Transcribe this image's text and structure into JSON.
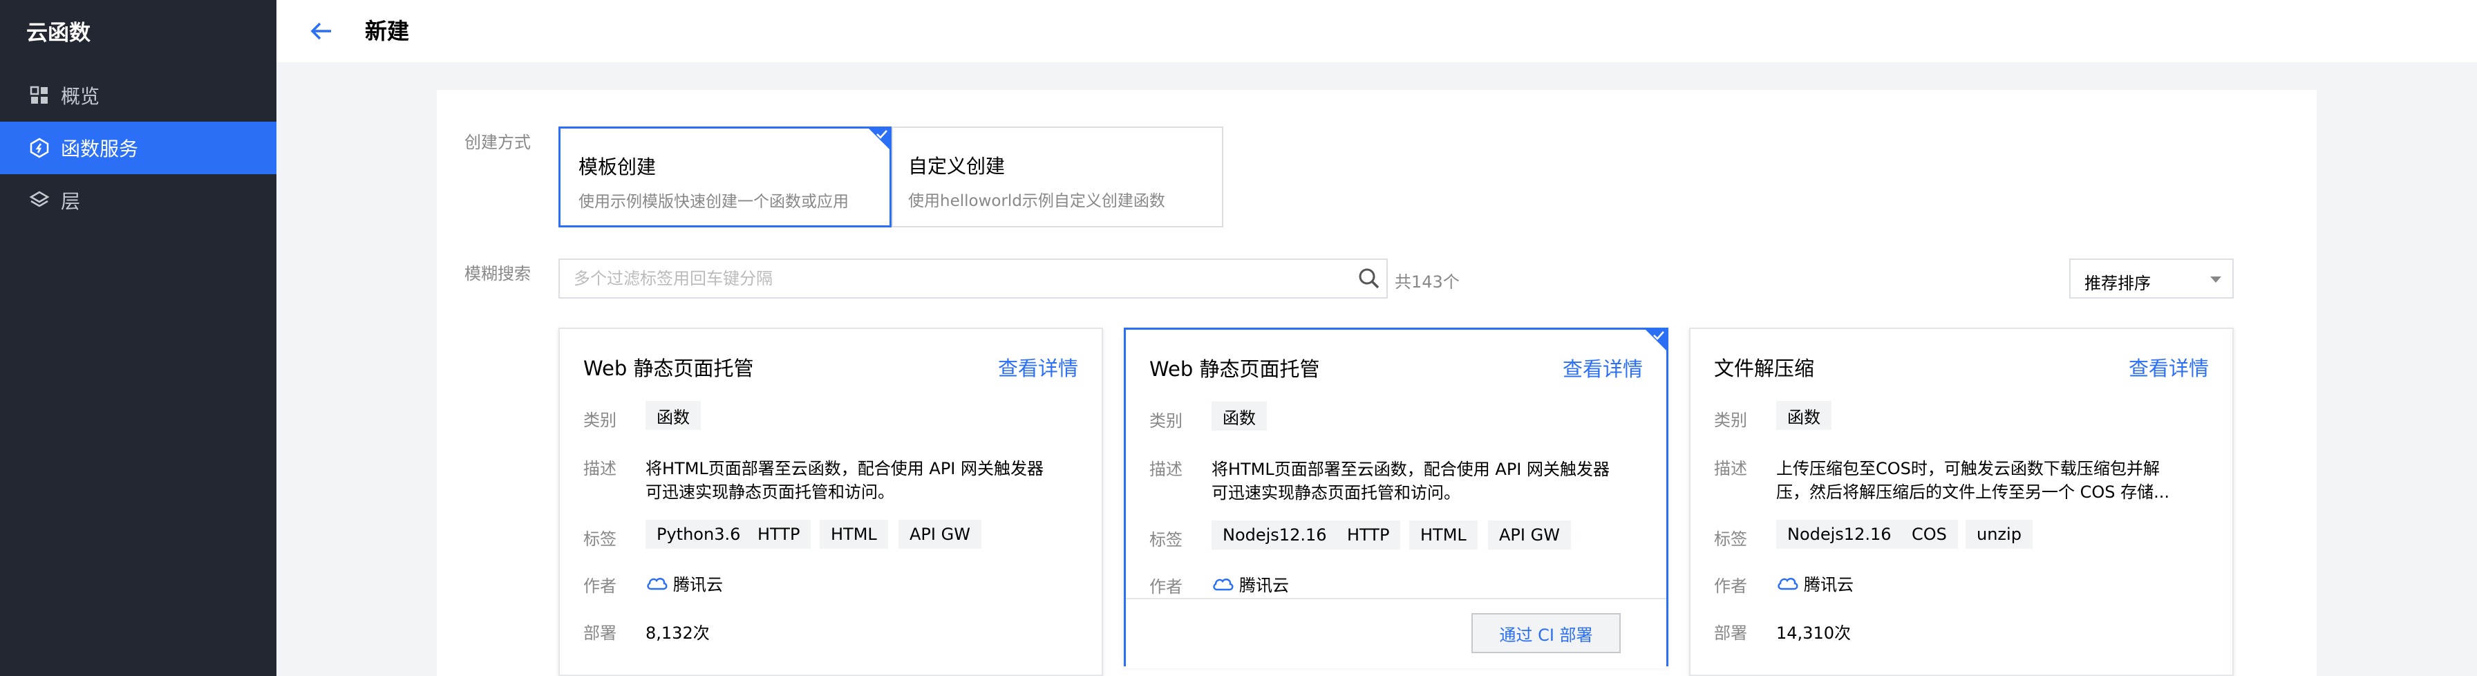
{
  "sidebar": {
    "title": "云函数",
    "items": [
      {
        "label": "概览",
        "icon": "grid-icon",
        "active": false
      },
      {
        "label": "函数服务",
        "icon": "function-icon",
        "active": true
      },
      {
        "label": "层",
        "icon": "layers-icon",
        "active": false
      }
    ]
  },
  "header": {
    "title": "新建"
  },
  "form": {
    "create_method_label": "创建方式",
    "methods": [
      {
        "title": "模板创建",
        "desc": "使用示例模版快速创建一个函数或应用",
        "selected": true
      },
      {
        "title": "自定义创建",
        "desc": "使用helloworld示例自定义创建函数",
        "selected": false
      }
    ],
    "search_label": "模糊搜索",
    "search_placeholder": "多个过滤标签用回车键分隔",
    "search_value": "",
    "count": "共143个",
    "sort_value": "推荐排序"
  },
  "labels": {
    "category": "类别",
    "description": "描述",
    "tags": "标签",
    "author": "作者",
    "deploy": "部署",
    "detail_link": "查看详情"
  },
  "templates": [
    {
      "title": "Web 静态页面托管",
      "category": "函数",
      "desc_lines": [
        "将HTML页面部署至云函数，配合使用 API 网关触发器",
        "可迅速实现静态页面托管和访问。"
      ],
      "tags": [
        "Python3.6",
        "HTTP",
        "HTML",
        "API GW"
      ],
      "author": "腾讯云",
      "deploys": "8,132次",
      "selected": false
    },
    {
      "title": "Web 静态页面托管",
      "category": "函数",
      "desc_lines": [
        "将HTML页面部署至云函数，配合使用 API 网关触发器",
        "可迅速实现静态页面托管和访问。"
      ],
      "tags": [
        "Nodejs12.16",
        "HTTP",
        "HTML",
        "API GW"
      ],
      "author": "腾讯云",
      "ci_button": "通过 CI 部署",
      "selected": true
    },
    {
      "title": "文件解压缩",
      "category": "函数",
      "desc_lines": [
        "上传压缩包至COS时，可触发云函数下载压缩包并解",
        "压，然后将解压缩后的文件上传至另一个 COS 存储..."
      ],
      "tags": [
        "Nodejs12.16",
        "COS",
        "unzip"
      ],
      "author": "腾讯云",
      "deploys": "14,310次",
      "selected": false
    }
  ],
  "colors": {
    "accent": "#2a6ff6",
    "sidebar_bg": "#232731",
    "tag_bg": "#f2f3f5"
  }
}
